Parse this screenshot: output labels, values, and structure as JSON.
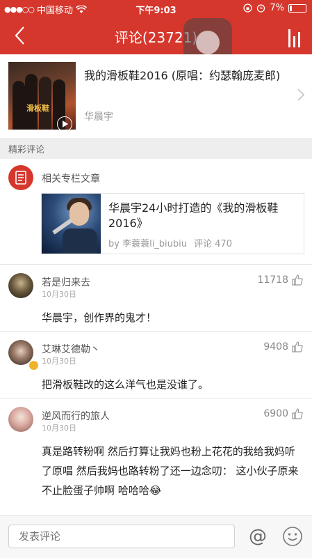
{
  "status_bar": {
    "carrier": "中国移动",
    "time": "下午9:03",
    "battery": "7%"
  },
  "nav": {
    "title": "评论(23721)"
  },
  "song": {
    "title": "我的滑板鞋2016 (原唱：约瑟翰庞麦郎)",
    "artist": "华晨宇",
    "cover_text": "滑板鞋"
  },
  "section": {
    "label": "精彩评论"
  },
  "related": {
    "label": "相关专栏文章",
    "article": {
      "title": "华晨宇24小时打造的《我的滑板鞋2016》",
      "author": "by 李蓑蓑li_biubiu",
      "comments": "评论 470"
    }
  },
  "comments": [
    {
      "name": "若是归来去",
      "date": "10月30日",
      "likes": "11718",
      "text": "华晨宇，创作界的鬼才！"
    },
    {
      "name": "艾琳艾德勒丶",
      "date": "10月30日",
      "likes": "9408",
      "text": "把滑板鞋改的这么洋气也是没谁了。"
    },
    {
      "name": "逆风而行的旅人",
      "date": "10月30日",
      "likes": "6900",
      "text": "真是路转粉啊 然后打算让我妈也粉上花花的我给我妈听了原唱 然后我妈也路转粉了还一边念叨： 这小伙子原来不止脸蛋子帅啊 哈哈哈😂"
    }
  ],
  "input": {
    "placeholder": "发表评论",
    "at_symbol": "@"
  },
  "colors": {
    "accent": "#d6372d"
  }
}
